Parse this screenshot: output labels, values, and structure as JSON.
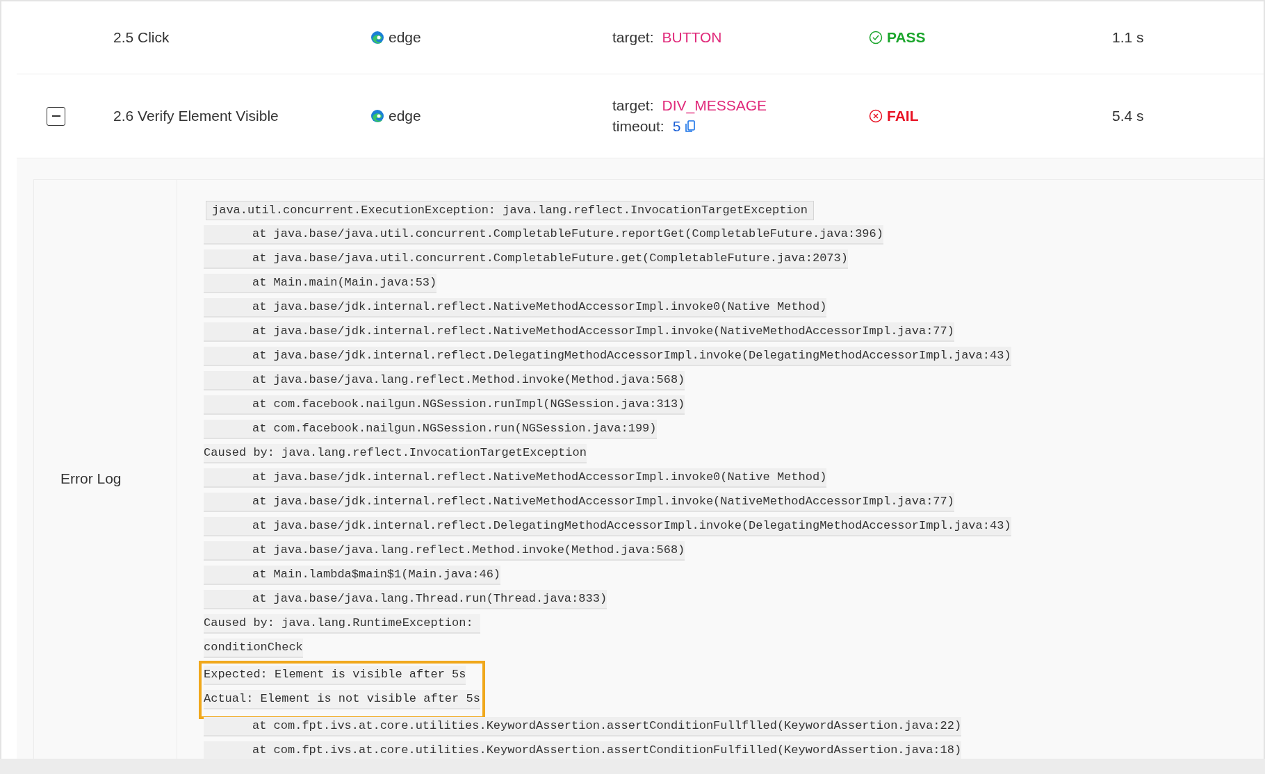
{
  "steps": [
    {
      "name": "2.5 Click",
      "browser": "edge",
      "params": [
        {
          "label": "target:",
          "value": "BUTTON",
          "kind": "text"
        }
      ],
      "status": {
        "label": "PASS",
        "kind": "pass"
      },
      "duration": "1.1 s"
    },
    {
      "name": "2.6 Verify Element Visible",
      "expanded": true,
      "browser": "edge",
      "params": [
        {
          "label": "target:",
          "value": "DIV_MESSAGE",
          "kind": "text"
        },
        {
          "label": "timeout:",
          "value": "5",
          "kind": "number"
        }
      ],
      "status": {
        "label": "FAIL",
        "kind": "fail"
      },
      "duration": "5.4 s"
    }
  ],
  "error_log": {
    "label": "Error Log",
    "lines": [
      {
        "text": "java.util.concurrent.ExecutionException: java.lang.reflect.InvocationTargetException",
        "kind": "header",
        "highlighted": false
      },
      {
        "text": "at java.base/java.util.concurrent.CompletableFuture.reportGet(CompletableFuture.java:396)",
        "kind": "frame",
        "highlighted": false
      },
      {
        "text": "at java.base/java.util.concurrent.CompletableFuture.get(CompletableFuture.java:2073)",
        "kind": "frame",
        "highlighted": false
      },
      {
        "text": "at Main.main(Main.java:53)",
        "kind": "frame",
        "highlighted": false
      },
      {
        "text": "at java.base/jdk.internal.reflect.NativeMethodAccessorImpl.invoke0(Native Method)",
        "kind": "frame",
        "highlighted": false
      },
      {
        "text": "at java.base/jdk.internal.reflect.NativeMethodAccessorImpl.invoke(NativeMethodAccessorImpl.java:77)",
        "kind": "frame",
        "highlighted": false
      },
      {
        "text": "at java.base/jdk.internal.reflect.DelegatingMethodAccessorImpl.invoke(DelegatingMethodAccessorImpl.java:43)",
        "kind": "frame",
        "highlighted": false
      },
      {
        "text": "at java.base/java.lang.reflect.Method.invoke(Method.java:568)",
        "kind": "frame",
        "highlighted": false
      },
      {
        "text": "at com.facebook.nailgun.NGSession.runImpl(NGSession.java:313)",
        "kind": "frame",
        "highlighted": false
      },
      {
        "text": "at com.facebook.nailgun.NGSession.run(NGSession.java:199)",
        "kind": "frame",
        "highlighted": false
      },
      {
        "text": "Caused by: java.lang.reflect.InvocationTargetException",
        "kind": "plain",
        "highlighted": false
      },
      {
        "text": "at java.base/jdk.internal.reflect.NativeMethodAccessorImpl.invoke0(Native Method)",
        "kind": "frame",
        "highlighted": false
      },
      {
        "text": "at java.base/jdk.internal.reflect.NativeMethodAccessorImpl.invoke(NativeMethodAccessorImpl.java:77)",
        "kind": "frame",
        "highlighted": false
      },
      {
        "text": "at java.base/jdk.internal.reflect.DelegatingMethodAccessorImpl.invoke(DelegatingMethodAccessorImpl.java:43)",
        "kind": "frame",
        "highlighted": false
      },
      {
        "text": "at java.base/java.lang.reflect.Method.invoke(Method.java:568)",
        "kind": "frame",
        "highlighted": false
      },
      {
        "text": "at Main.lambda$main$1(Main.java:46)",
        "kind": "frame",
        "highlighted": false
      },
      {
        "text": "at java.base/java.lang.Thread.run(Thread.java:833)",
        "kind": "frame",
        "highlighted": false
      },
      {
        "text": "Caused by: java.lang.RuntimeException: ",
        "kind": "plain",
        "highlighted": false
      },
      {
        "text": "conditionCheck",
        "kind": "plain",
        "highlighted": false
      },
      {
        "text": "Expected: Element is visible after 5s",
        "kind": "plain",
        "highlighted": true
      },
      {
        "text": "Actual: Element is not visible after 5s",
        "kind": "plain",
        "highlighted": true
      },
      {
        "text": "at com.fpt.ivs.at.core.utilities.KeywordAssertion.assertConditionFullflled(KeywordAssertion.java:22)",
        "kind": "frame",
        "highlighted": false
      },
      {
        "text": "at com.fpt.ivs.at.core.utilities.KeywordAssertion.assertConditionFulfilled(KeywordAssertion.java:18)",
        "kind": "frame",
        "highlighted": false
      }
    ]
  }
}
